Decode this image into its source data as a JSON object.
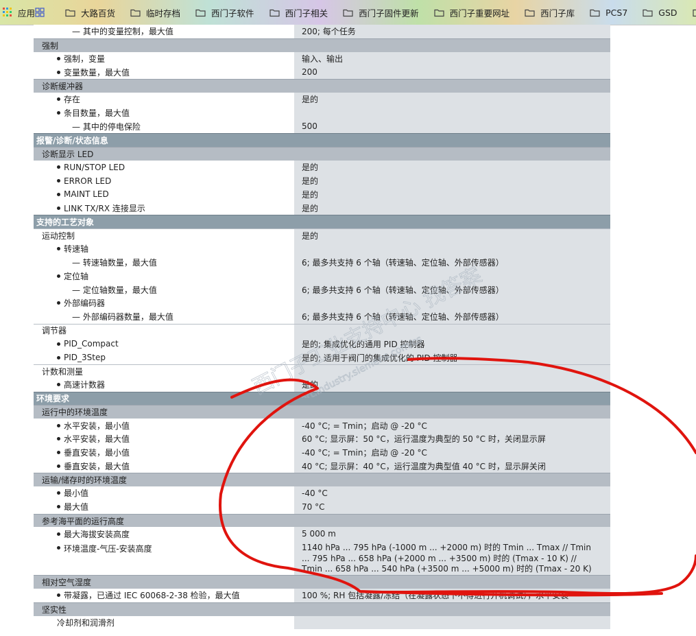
{
  "bookmarks": [
    {
      "icon": "apps-grid-icon",
      "label": "应用"
    },
    {
      "icon": "bookmark-grid-icon",
      "label": ""
    },
    {
      "icon": "folder-icon",
      "label": "大路百货"
    },
    {
      "icon": "folder-icon",
      "label": "临时存档"
    },
    {
      "icon": "folder-icon",
      "label": "西门子软件"
    },
    {
      "icon": "folder-icon",
      "label": "西门子相关"
    },
    {
      "icon": "folder-icon",
      "label": "西门子固件更新"
    },
    {
      "icon": "folder-icon",
      "label": "西门子重要网址"
    },
    {
      "icon": "folder-icon",
      "label": "西门子库"
    },
    {
      "icon": "folder-icon",
      "label": "PCS7"
    },
    {
      "icon": "folder-icon",
      "label": "GSD"
    },
    {
      "icon": "folder-icon",
      "label": ""
    }
  ],
  "spec": {
    "rows": [
      {
        "kind": "d2",
        "label": "— 其中的变量控制，最大值",
        "value": "200; 每个任务"
      },
      {
        "kind": "sub",
        "label": "强制"
      },
      {
        "kind": "b1",
        "label": "强制，变量",
        "value": "输入、输出"
      },
      {
        "kind": "b1",
        "label": "变量数量，最大值",
        "value": "200"
      },
      {
        "kind": "sub",
        "label": "诊断缓冲器"
      },
      {
        "kind": "b1",
        "label": "存在",
        "value": "是的"
      },
      {
        "kind": "b1",
        "label": "条目数量，最大值",
        "value": ""
      },
      {
        "kind": "d2",
        "label": "— 其中的停电保险",
        "value": "500"
      },
      {
        "kind": "cat",
        "label": "报警/诊断/状态信息"
      },
      {
        "kind": "sub",
        "label": "诊断显示 LED"
      },
      {
        "kind": "b1",
        "label": "RUN/STOP LED",
        "value": "是的"
      },
      {
        "kind": "b1",
        "label": "ERROR LED",
        "value": "是的"
      },
      {
        "kind": "b1",
        "label": "MAINT LED",
        "value": "是的"
      },
      {
        "kind": "b1",
        "label": "LINK TX/RX 连接显示",
        "value": "是的"
      },
      {
        "kind": "cat",
        "label": "支持的工艺对象"
      },
      {
        "kind": "sec",
        "label": "运动控制",
        "value": "是的"
      },
      {
        "kind": "b1",
        "label": "转速轴",
        "value": ""
      },
      {
        "kind": "d2",
        "label": "— 转速轴数量，最大值",
        "value": "6; 最多共支持 6 个轴（转速轴、定位轴、外部传感器）"
      },
      {
        "kind": "b1",
        "label": "定位轴",
        "value": ""
      },
      {
        "kind": "d2",
        "label": "— 定位轴数量，最大值",
        "value": "6; 最多共支持 6 个轴（转速轴、定位轴、外部传感器）"
      },
      {
        "kind": "b1",
        "label": "外部编码器",
        "value": ""
      },
      {
        "kind": "d2",
        "label": "— 外部编码器数量，最大值",
        "value": "6; 最多共支持 6 个轴（转速轴、定位轴、外部传感器）"
      },
      {
        "kind": "sec",
        "label": "调节器",
        "value": ""
      },
      {
        "kind": "b1",
        "label": "PID_Compact",
        "value": "是的; 集成优化的通用 PID 控制器"
      },
      {
        "kind": "b1",
        "label": "PID_3Step",
        "value": "是的; 适用于阀门的集成优化的 PID 控制器"
      },
      {
        "kind": "sec",
        "label": "计数和测量",
        "value": ""
      },
      {
        "kind": "b1",
        "label": "高速计数器",
        "value": "是的"
      },
      {
        "kind": "cat",
        "label": "环境要求"
      },
      {
        "kind": "sub",
        "label": "运行中的环境温度"
      },
      {
        "kind": "b1",
        "label": "水平安装，最小值",
        "value": "-40 °C; = Tmin；启动 @ -20 °C"
      },
      {
        "kind": "b1",
        "label": "水平安装，最大值",
        "value": "60 °C; 显示屏：50 °C，运行温度为典型的 50 °C 时，关闭显示屏"
      },
      {
        "kind": "b1",
        "label": "垂直安装，最小值",
        "value": "-40 °C; = Tmin；启动 @ -20 °C"
      },
      {
        "kind": "b1",
        "label": "垂直安装，最大值",
        "value": "40 °C; 显示屏：40 °C，运行温度为典型值 40 °C 时，显示屏关闭"
      },
      {
        "kind": "sub",
        "label": "运输/储存时的环境温度"
      },
      {
        "kind": "b1",
        "label": "最小值",
        "value": "-40 °C"
      },
      {
        "kind": "b1",
        "label": "最大值",
        "value": "70 °C"
      },
      {
        "kind": "sub",
        "label": "参考海平面的运行高度"
      },
      {
        "kind": "b1",
        "label": "最大海拔安装高度",
        "value": "5 000 m"
      },
      {
        "kind": "b1tall",
        "label": "环境温度-气压-安装高度",
        "value": "1140 hPa ... 795 hPa (-1000 m ... +2000 m) 时的 Tmin ... Tmax // Tmin ... 795 hPa ... 658 hPa (+2000 m ... +3500 m) 时的 (Tmax - 10 K) // Tmin ... 658 hPa ... 540 hPa (+3500 m ... +5000 m) 时的 (Tmax - 20 K)"
      },
      {
        "kind": "sub",
        "label": "相对空气湿度"
      },
      {
        "kind": "b1",
        "label": "带凝露，已通过 IEC 60068-2-38 检验，最大值",
        "value": "100 %; RH 包括凝露/冻结（在凝露状态下不得进行开机调试），水平安装"
      },
      {
        "kind": "sub",
        "label": "坚实性"
      },
      {
        "kind": "ind",
        "label": "冷却剂和润滑剂",
        "value": ""
      }
    ]
  },
  "watermark": {
    "line1": "西门子工业支持中心 找答案",
    "line2": "support.industry.siemens.com/cs"
  },
  "colors": {
    "category_bar": "#8d9ea9",
    "subheader_bar": "#b5bcc4",
    "value_cell": "#dde1e5",
    "annotation": "#e0140e"
  }
}
